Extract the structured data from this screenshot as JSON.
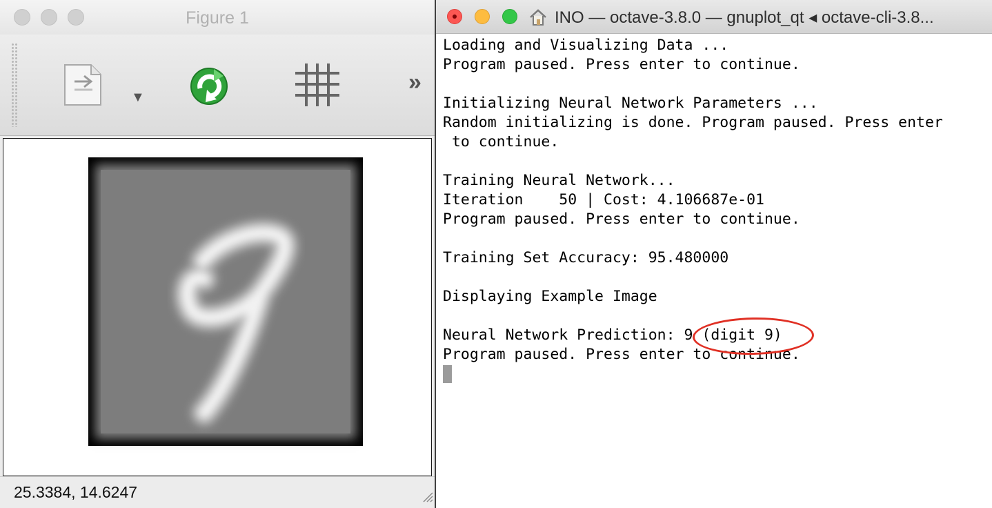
{
  "figure_window": {
    "title": "Figure 1",
    "toolbar": {
      "items": [
        {
          "name": "export-icon"
        },
        {
          "name": "dropdown-arrow-icon",
          "glyph": "▼"
        },
        {
          "name": "refresh-icon"
        },
        {
          "name": "grid-icon"
        },
        {
          "name": "overflow-chevron-icon",
          "glyph": "»"
        }
      ]
    },
    "image": {
      "description_digit": "9",
      "frame_color": "#000000",
      "background_gray": "#7d7d7d",
      "stroke_color": "#f2f2f2"
    },
    "status": {
      "coords": "25.3384,  14.6247"
    }
  },
  "terminal_window": {
    "title": "INO — octave-3.8.0 — gnuplot_qt ◂ octave-cli-3.8...",
    "traffic_lights": {
      "close": "#fc5753",
      "minimize": "#fdbc40",
      "zoom": "#33c748"
    },
    "lines": [
      "Loading and Visualizing Data ...",
      "Program paused. Press enter to continue.",
      "",
      "Initializing Neural Network Parameters ...",
      "Random initializing is done. Program paused. Press enter",
      " to continue.",
      "",
      "Training Neural Network...",
      "Iteration    50 | Cost: 4.106687e-01",
      "Program paused. Press enter to continue.",
      "",
      "Training Set Accuracy: 95.480000",
      "",
      "Displaying Example Image",
      "",
      "Neural Network Prediction: 9 (digit 9)",
      "Program paused. Press enter to continue."
    ],
    "annotation_color": "#e03024"
  }
}
